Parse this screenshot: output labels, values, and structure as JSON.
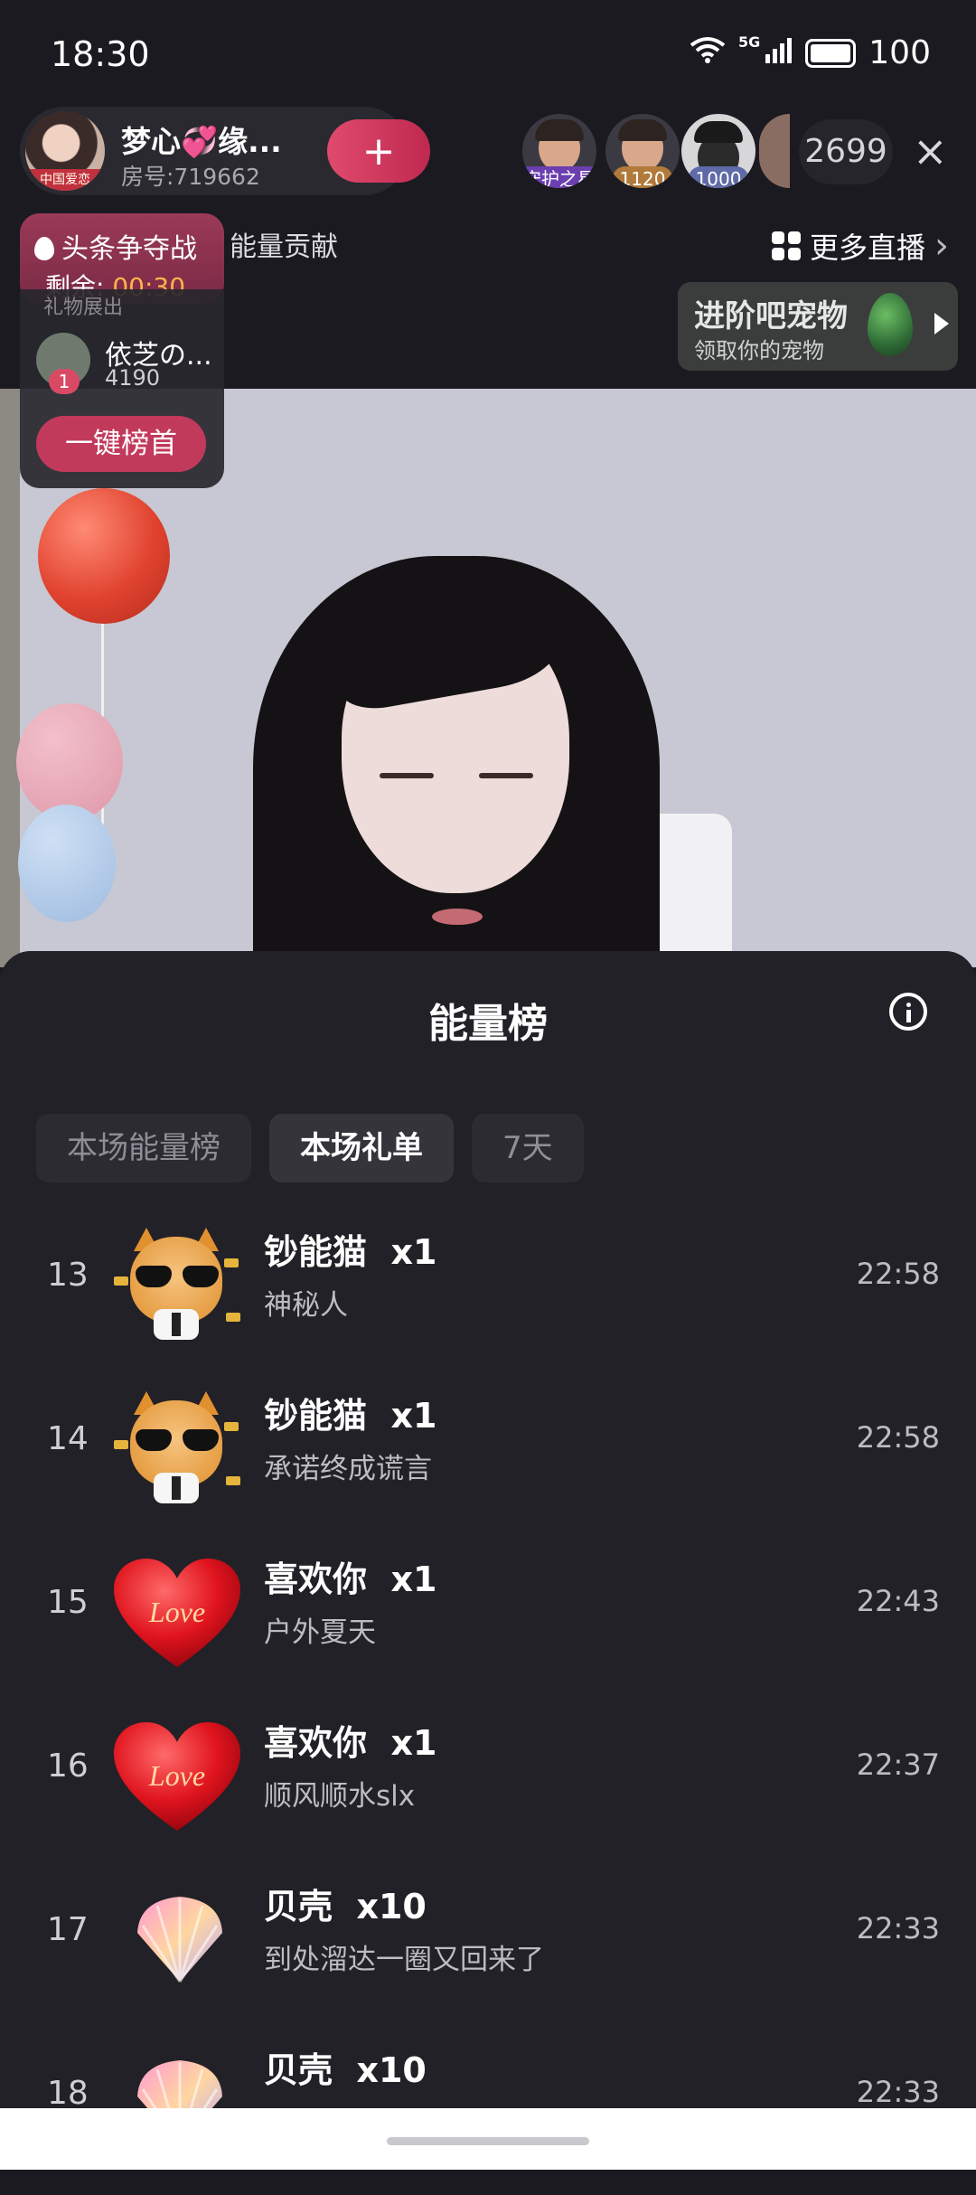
{
  "status": {
    "time": "18:30",
    "network": "5G",
    "battery": "100"
  },
  "host": {
    "name": "梦心💞缘...",
    "room": "房号:719662",
    "badge": "中国爱恋",
    "follow": "+"
  },
  "viewers": [
    {
      "badge": "守护之星",
      "badge_color": "#6b3fb0"
    },
    {
      "badge": "1120",
      "badge_color": "#b07a3a"
    },
    {
      "badge": "1000",
      "badge_color": "#5f6aa8"
    }
  ],
  "viewer_count": "2699",
  "close": "×",
  "headline": {
    "title": "头条争夺战",
    "remain_label": "剩余:",
    "countdown": "00:30"
  },
  "energy_contrib": "能量贡献",
  "more_live": {
    "label": "更多直播",
    "chevron": "›"
  },
  "pet_banner": {
    "title": "进阶吧宠物",
    "subtitle": "领取你的宠物"
  },
  "gift_card": {
    "sub": "礼物展出",
    "user": "依芝の...",
    "rank": "1",
    "value": "4190",
    "button": "一键榜首"
  },
  "sheet": {
    "title": "能量榜",
    "tabs": [
      {
        "label": "本场能量榜",
        "active": false
      },
      {
        "label": "本场礼单",
        "active": true
      },
      {
        "label": "7天",
        "active": false
      }
    ],
    "rows": [
      {
        "rank": "13",
        "gift": "钞能猫",
        "qty": "x1",
        "user": "神秘人",
        "time": "22:58",
        "icon": "cat-gift-icon"
      },
      {
        "rank": "14",
        "gift": "钞能猫",
        "qty": "x1",
        "user": "承诺终成谎言",
        "time": "22:58",
        "icon": "cat-gift-icon"
      },
      {
        "rank": "15",
        "gift": "喜欢你",
        "qty": "x1",
        "user": "户外夏天",
        "time": "22:43",
        "icon": "love-heart-icon"
      },
      {
        "rank": "16",
        "gift": "喜欢你",
        "qty": "x1",
        "user": "顺风顺水slx",
        "time": "22:37",
        "icon": "love-heart-icon"
      },
      {
        "rank": "17",
        "gift": "贝壳",
        "qty": "x10",
        "user": "到处溜达一圈又回来了",
        "time": "22:33",
        "icon": "shell-icon"
      },
      {
        "rank": "18",
        "gift": "贝壳",
        "qty": "x10",
        "user": "",
        "time": "22:33",
        "icon": "shell-icon"
      }
    ],
    "love_text": "Love"
  }
}
